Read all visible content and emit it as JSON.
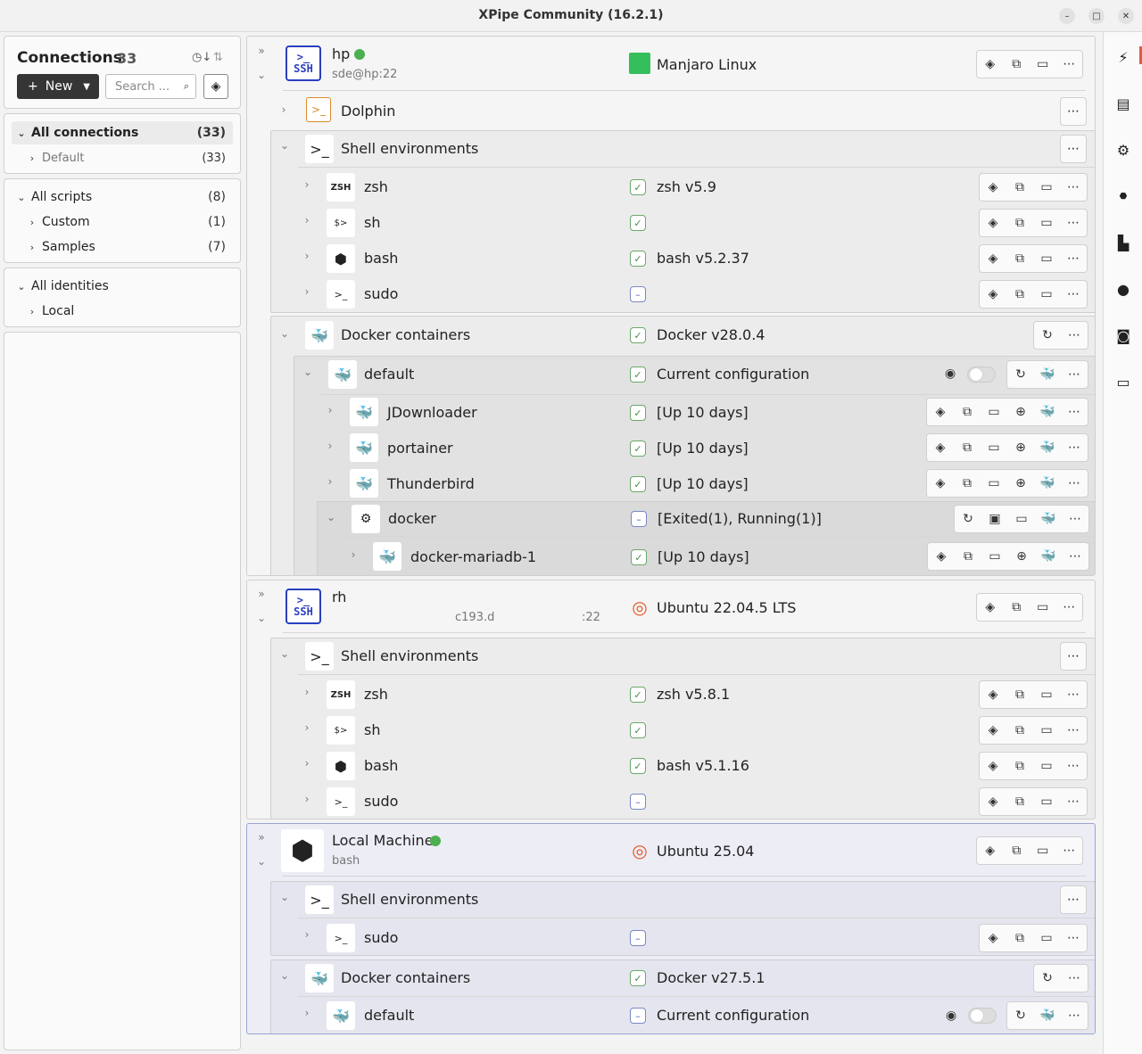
{
  "window": {
    "title": "XPipe Community (16.2.1)"
  },
  "sidebar": {
    "title": "Connections",
    "count": "33",
    "new_label": "New",
    "search_placeholder": "Search ...",
    "connections": [
      {
        "label": "All connections",
        "count": "(33)"
      },
      {
        "label": "Default",
        "count": "(33)"
      }
    ],
    "scripts": [
      {
        "label": "All scripts",
        "count": "(8)"
      },
      {
        "label": "Custom",
        "count": "(1)"
      },
      {
        "label": "Samples",
        "count": "(7)"
      }
    ],
    "identities": [
      {
        "label": "All identities"
      },
      {
        "label": "Local"
      }
    ]
  },
  "hp": {
    "name": "hp",
    "sub": "sde@hp:22",
    "os": "Manjaro Linux",
    "dolphin": "Dolphin",
    "shell_group": "Shell environments",
    "shells": [
      {
        "name": "zsh",
        "status": "zsh v5.9"
      },
      {
        "name": "sh",
        "status": ""
      },
      {
        "name": "bash",
        "status": "bash v5.2.37"
      },
      {
        "name": "sudo",
        "status": ""
      }
    ],
    "docker_group": "Docker containers",
    "docker_status": "Docker v28.0.4",
    "default": "default",
    "default_status": "Current configuration",
    "containers": [
      {
        "name": "JDownloader",
        "status": "[Up 10 days]"
      },
      {
        "name": "portainer",
        "status": "[Up 10 days]"
      },
      {
        "name": "Thunderbird",
        "status": "[Up 10 days]"
      }
    ],
    "compose": "docker",
    "compose_status": "[Exited(1), Running(1)]",
    "mariadb": "docker-mariadb-1",
    "mariadb_status": "[Up 10 days]"
  },
  "rh": {
    "name": "rh",
    "sub1": "c193.d",
    "sub2": ":22",
    "os": "Ubuntu 22.04.5 LTS",
    "shell_group": "Shell environments",
    "shells": [
      {
        "name": "zsh",
        "status": "zsh v5.8.1"
      },
      {
        "name": "sh",
        "status": ""
      },
      {
        "name": "bash",
        "status": "bash v5.1.16"
      },
      {
        "name": "sudo",
        "status": ""
      }
    ]
  },
  "local": {
    "name": "Local Machine",
    "sub": "bash",
    "os": "Ubuntu 25.04",
    "shell_group": "Shell environments",
    "sudo": "sudo",
    "docker_group": "Docker containers",
    "docker_status": "Docker v27.5.1",
    "default": "default",
    "default_status": "Current configuration"
  },
  "colors": {
    "accent": "#2a3fc0",
    "online": "#4caf50",
    "selected_card_border": "#9aa4d6"
  }
}
